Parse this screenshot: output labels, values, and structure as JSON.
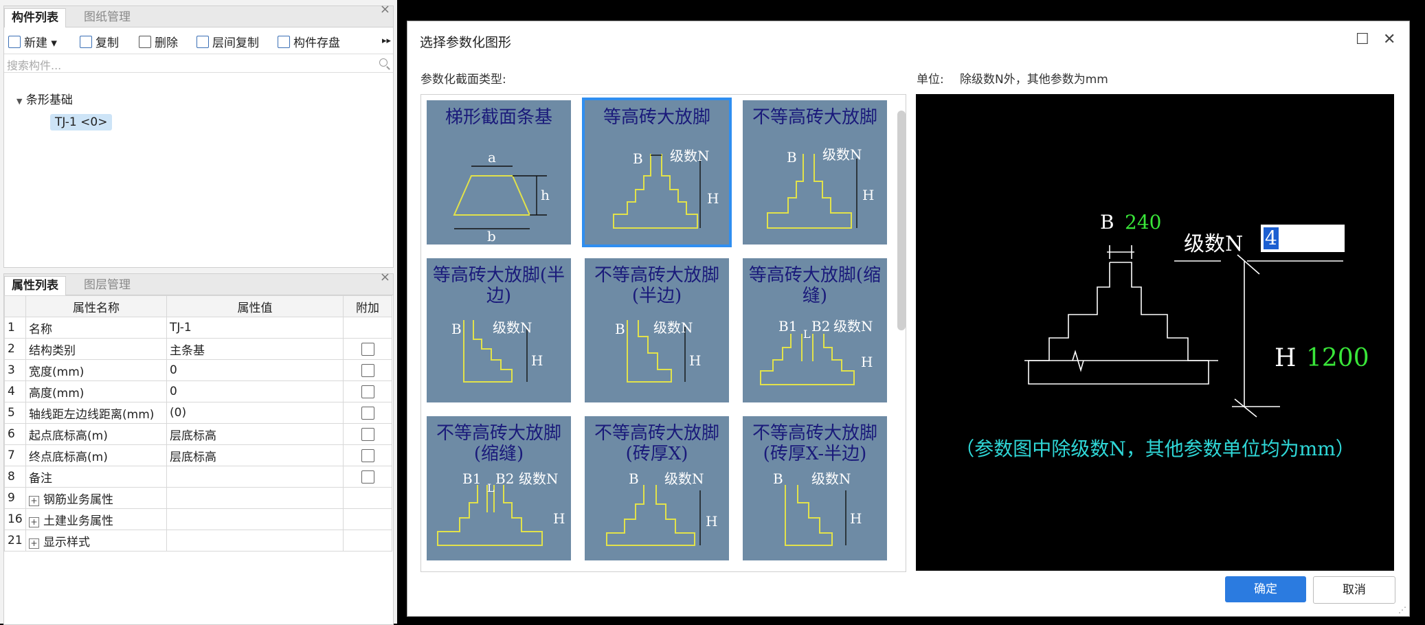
{
  "left_panel": {
    "tabs": [
      "构件列表",
      "图纸管理"
    ],
    "toolbar": {
      "new": "新建",
      "copy": "复制",
      "delete": "删除",
      "floor_copy": "层间复制",
      "save": "构件存盘"
    },
    "search_placeholder": "搜索构件...",
    "tree": {
      "root": "条形基础",
      "child": "TJ-1 <0>"
    }
  },
  "props_panel": {
    "tabs": [
      "属性列表",
      "图层管理"
    ],
    "headers": [
      "属性名称",
      "属性值",
      "附加"
    ],
    "rows": [
      {
        "num": "1",
        "name": "名称",
        "value": "TJ-1"
      },
      {
        "num": "2",
        "name": "结构类别",
        "value": "主条基"
      },
      {
        "num": "3",
        "name": "宽度(mm)",
        "value": "0"
      },
      {
        "num": "4",
        "name": "高度(mm)",
        "value": "0"
      },
      {
        "num": "5",
        "name": "轴线距左边线距离(mm)",
        "value": "(0)"
      },
      {
        "num": "6",
        "name": "起点底标高(m)",
        "value": "层底标高"
      },
      {
        "num": "7",
        "name": "终点底标高(m)",
        "value": "层底标高"
      },
      {
        "num": "8",
        "name": "备注",
        "value": ""
      },
      {
        "num": "9",
        "name": "钢筋业务属性",
        "value": ""
      },
      {
        "num": "16",
        "name": "土建业务属性",
        "value": ""
      },
      {
        "num": "21",
        "name": "显示样式",
        "value": ""
      }
    ]
  },
  "dialog": {
    "title": "选择参数化图形",
    "type_label": "参数化截面类型:",
    "unit_label": "单位:",
    "unit_text": "除级数N外，其他参数为mm",
    "ok": "确定",
    "cancel": "取消",
    "shapes": [
      {
        "caption": "梯形截面条基",
        "sym": [
          "a",
          "h",
          "b"
        ]
      },
      {
        "caption": "等高砖大放脚",
        "sym": [
          "B",
          "级数N",
          "H"
        ]
      },
      {
        "caption": "不等高砖大放脚",
        "sym": [
          "B",
          "级数N",
          "H"
        ]
      },
      {
        "caption": "等高砖大放脚(半边)",
        "sym": [
          "B",
          "级数N",
          "H"
        ]
      },
      {
        "caption": "不等高砖大放脚(半边)",
        "sym": [
          "B",
          "级数N",
          "H"
        ]
      },
      {
        "caption": "等高砖大放脚(缩缝)",
        "sym": [
          "B1",
          "B2",
          "级数N",
          "H",
          "L"
        ]
      },
      {
        "caption": "不等高砖大放脚(缩缝)",
        "sym": [
          "B1",
          "B2",
          "级数N",
          "H",
          "L"
        ]
      },
      {
        "caption": "不等高砖大放脚(砖厚X)",
        "sym": [
          "B",
          "级数N",
          "H"
        ]
      },
      {
        "caption": "不等高砖大放脚(砖厚X-半边)",
        "sym": [
          "B",
          "级数N",
          "H"
        ]
      }
    ],
    "preview": {
      "b_label": "B",
      "b_value": "240",
      "n_label": "级数N",
      "n_value": "4",
      "h_label": "H",
      "h_value": "1200",
      "note": "（参数图中除级数N，其他参数单位均为mm）"
    }
  },
  "colors": {
    "accent": "#2b7be0",
    "cell_bg": "#6e8ba5",
    "cad_green": "#39e639",
    "cad_cyan": "#2fd7d7"
  }
}
